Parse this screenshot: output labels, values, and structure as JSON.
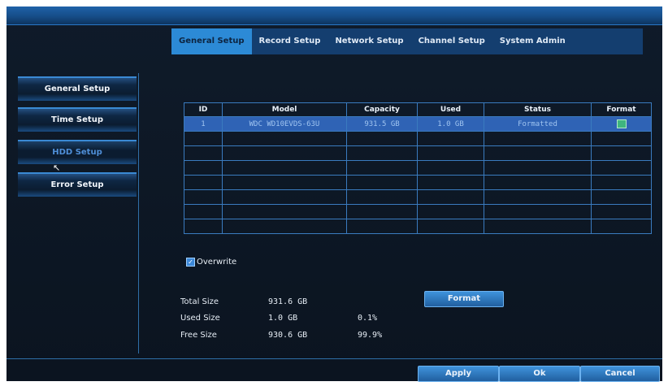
{
  "tabs": [
    "General Setup",
    "Record Setup",
    "Network Setup",
    "Channel Setup",
    "System Admin"
  ],
  "active_tab": 0,
  "sidebar": {
    "items": [
      {
        "label": "General Setup"
      },
      {
        "label": "Time Setup"
      },
      {
        "label": "HDD Setup"
      },
      {
        "label": "Error Setup"
      }
    ],
    "active": 2
  },
  "table": {
    "headers": [
      "ID",
      "Model",
      "Capacity",
      "Used",
      "Status",
      "Format"
    ],
    "rows": [
      {
        "id": "1",
        "model": "WDC WD10EVDS-63U",
        "capacity": "931.5 GB",
        "used": "1.0 GB",
        "status": "Formatted"
      }
    ],
    "empty_rows": 7
  },
  "overwrite": {
    "label": "Overwrite",
    "checked": true
  },
  "stats": {
    "total_label": "Total Size",
    "total_value": "931.6 GB",
    "used_label": "Used Size",
    "used_value": "1.0 GB",
    "used_pct": "0.1%",
    "free_label": "Free Size",
    "free_value": "930.6 GB",
    "free_pct": "99.9%"
  },
  "buttons": {
    "format": "Format",
    "apply": "Apply",
    "ok": "Ok",
    "cancel": "Cancel"
  },
  "colors": {
    "accent": "#2c8ad6",
    "background": "#0b1420",
    "grid_line": "#3a7bbf",
    "selected_row": "#2f63b5"
  }
}
